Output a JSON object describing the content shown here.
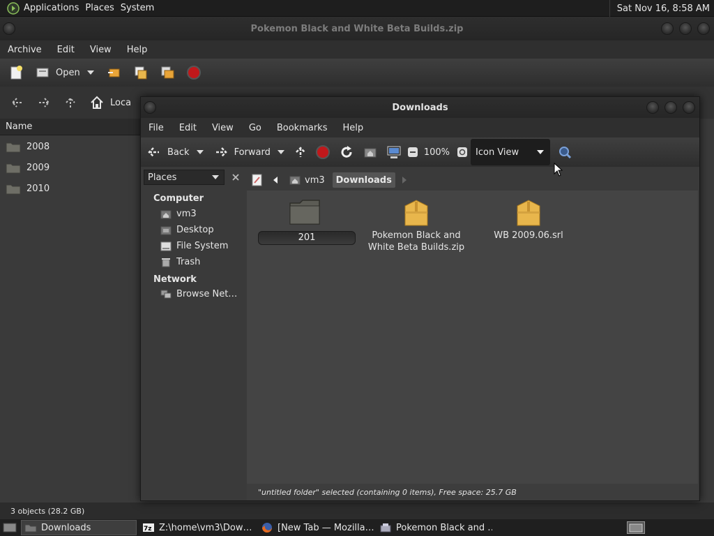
{
  "top_panel": {
    "menus": [
      "Applications",
      "Places",
      "System"
    ],
    "clock": "Sat Nov 16,  8:58 AM"
  },
  "archive_window": {
    "title": "Pokemon Black and White Beta Builds.zip",
    "menu": [
      "Archive",
      "Edit",
      "View",
      "Help"
    ],
    "open_label": "Open",
    "location_label": "Loca",
    "column_header": "Name",
    "rows": [
      "2008",
      "2009",
      "2010"
    ],
    "status": "3 objects (28.2 GB)"
  },
  "downloads_window": {
    "title": "Downloads",
    "menu": [
      "File",
      "Edit",
      "View",
      "Go",
      "Bookmarks",
      "Help"
    ],
    "back_label": "Back",
    "forward_label": "Forward",
    "zoom": "100%",
    "view_mode": "Icon View",
    "sidebar": {
      "combo": "Places",
      "computer_heading": "Computer",
      "computer_items": [
        "vm3",
        "Desktop",
        "File System",
        "Trash"
      ],
      "network_heading": "Network",
      "network_items": [
        "Browse Net…"
      ]
    },
    "path": [
      "vm3",
      "Downloads"
    ],
    "files": {
      "new_folder_name": "201",
      "zip_label_1": "Pokemon Black and",
      "zip_label_2": "White Beta Builds.zip",
      "srl_label": "WB 2009.06.srl"
    },
    "status": "\"untitled folder\" selected (containing 0 items), Free space: 25.7 GB"
  },
  "taskbar": {
    "items": [
      "Downloads",
      "Z:\\home\\vm3\\Dow…",
      "[New Tab — Mozilla…",
      "Pokemon Black and …"
    ]
  },
  "colors": {
    "folder": "#e8b64c",
    "stop": "#c0181b"
  }
}
